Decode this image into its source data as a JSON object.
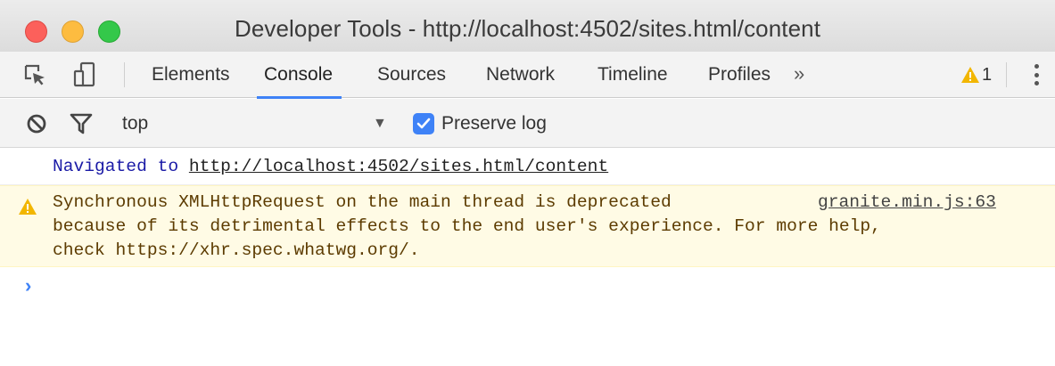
{
  "window": {
    "title": "Developer Tools - http://localhost:4502/sites.html/content"
  },
  "tabs": [
    {
      "label": "Elements",
      "active": false
    },
    {
      "label": "Console",
      "active": true
    },
    {
      "label": "Sources",
      "active": false
    },
    {
      "label": "Network",
      "active": false
    },
    {
      "label": "Timeline",
      "active": false
    },
    {
      "label": "Profiles",
      "active": false
    }
  ],
  "tabbar": {
    "more": "»",
    "warning_count": "1"
  },
  "toolbar": {
    "context": "top",
    "context_arrow": "▼",
    "preserve_log_label": "Preserve log",
    "preserve_log_checked": true
  },
  "console": {
    "navigated_prefix": "Navigated to ",
    "navigated_url": "http://localhost:4502/sites.html/content",
    "warning": {
      "line1": "Synchronous XMLHttpRequest on the main thread is deprecated",
      "line2": "because of its detrimental effects to the end user's experience. For more help,",
      "line3": "check https://xhr.spec.whatwg.org/.",
      "source": "granite.min.js:63"
    },
    "prompt": "›"
  },
  "colors": {
    "accent": "#3e82f7",
    "warning_bg": "#fffbe5",
    "warning_text": "#5c3b00",
    "navigated_text": "#1a1aa6"
  }
}
